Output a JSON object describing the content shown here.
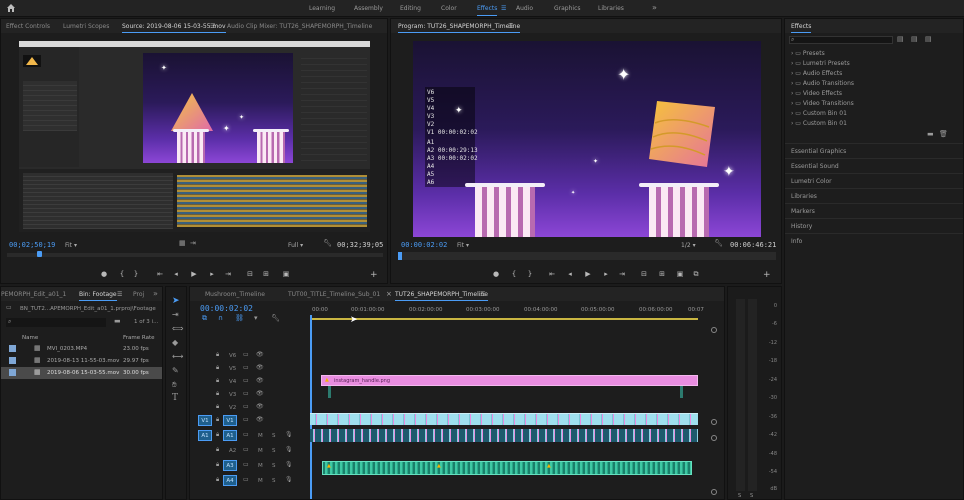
{
  "workspaces": {
    "items": [
      "Learning",
      "Assembly",
      "Editing",
      "Color",
      "Effects",
      "Audio",
      "Graphics",
      "Libraries"
    ],
    "active": "Effects",
    "more": "»"
  },
  "source_panel": {
    "tabs": [
      "Effect Controls",
      "Lumetri Scopes",
      "Source: 2019-08-06 15-03-55.mov",
      "Audio Clip Mixer: TUT26_SHAPEMORPH_Timeline"
    ],
    "active_tab": "Source: 2019-08-06 15-03-55.mov",
    "timecode_in": "00;02;50;19",
    "fit": "Fit",
    "quality": "Full",
    "timecode_out": "00;32;39;05"
  },
  "program_panel": {
    "title": "Program: TUT26_SHAPEMORPH_Timeline",
    "overlay_lines": [
      "V6",
      "V5",
      "V4",
      "V3",
      "V2",
      "V1 00:00:02:02",
      "A1",
      "A2 00:00:29:13",
      "A3 00:00:02:02",
      "A4",
      "A5",
      "A6"
    ],
    "timecode_in": "00:00:02:02",
    "fit": "Fit",
    "resolution": "1/2",
    "timecode_out": "00:06:46:21"
  },
  "transport": {
    "controls": [
      "marker",
      "in-point",
      "out-point",
      "go-to-in",
      "step-back",
      "play",
      "step-forward",
      "go-to-out",
      "insert",
      "overwrite",
      "export-frame",
      "add"
    ]
  },
  "effects_panel": {
    "title": "Effects",
    "search_placeholder": "",
    "folders": [
      "Presets",
      "Lumetri Presets",
      "Audio Effects",
      "Audio Transitions",
      "Video Effects",
      "Video Transitions",
      "Custom Bin 01",
      "Custom Bin 01"
    ],
    "sections": [
      "Essential Graphics",
      "Essential Sound",
      "Lumetri Color",
      "Libraries",
      "Markers",
      "History",
      "Info"
    ]
  },
  "project_panel": {
    "tabs": [
      "PEMORPH_Edit_a01_1",
      "Bin: Footage",
      "Proj"
    ],
    "active_tab": "Bin: Footage",
    "more": "»",
    "path": "BN_TUT2...APEMORPH_Edit_a01_1.prproj\\Footage",
    "count": "1 of 3 i...",
    "columns": [
      "Name",
      "Frame Rate"
    ],
    "rows": [
      {
        "name": "MVI_0203.MP4",
        "rate": "23.00 fps"
      },
      {
        "name": "2019-08-13 11-55-03.mov",
        "rate": "29.97 fps"
      },
      {
        "name": "2019-08-06 15-03-55.mov",
        "rate": "30.00 fps"
      }
    ],
    "selected_row": 2
  },
  "timeline": {
    "tabs": [
      "Mushroom_Timeline",
      "TUT00_TITLE_Timeline_Sub_01",
      "TUT26_SHAPEMORPH_Timeline"
    ],
    "active_tab": "TUT26_SHAPEMORPH_Timeline",
    "timecode": "00:00:02:02",
    "ruler": [
      "00:00",
      "00:01:00:00",
      "00:02:00:00",
      "00:03:00:00",
      "00:04:00:00",
      "00:05:00:00",
      "00:06:00:00",
      "00:07"
    ],
    "video_tracks": [
      "V6",
      "V5",
      "V4",
      "V3",
      "V2",
      "V1"
    ],
    "audio_tracks": [
      "A1",
      "A2",
      "A3",
      "A4"
    ],
    "source_patch_video": "V1",
    "source_patch_audio": "A1",
    "clip_label": "instagram_handle.png",
    "track_toggle_m": "M",
    "track_toggle_s": "S"
  },
  "audio_meter": {
    "scale": [
      "0",
      "-6",
      "-12",
      "-18",
      "-24",
      "-30",
      "-36",
      "-42",
      "-48",
      "-54",
      "dB"
    ],
    "channels": [
      "S",
      "S"
    ]
  },
  "colors": {
    "accent": "#4b9cf5",
    "clip_pink": "#e98de0",
    "clip_cyan": "#9fe0ee",
    "audio_green": "#3ec8a3",
    "panel_bg": "#1d1d1d"
  }
}
